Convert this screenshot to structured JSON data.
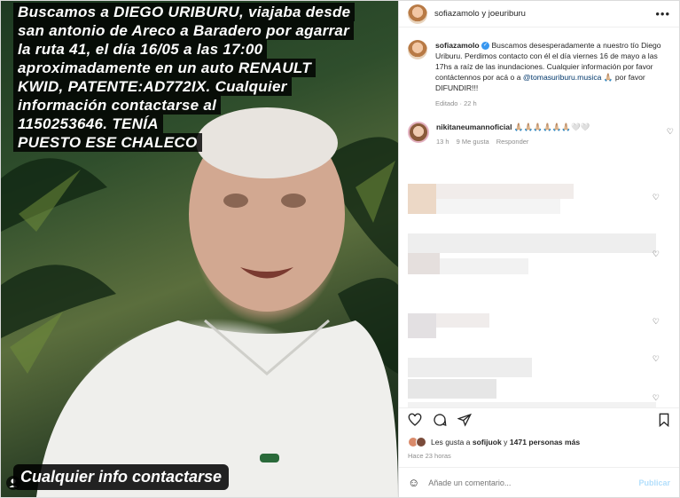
{
  "media": {
    "caption_lines": [
      "Buscamos a DIEGO URIBURU, viajaba desde",
      "san antonio de Areco a Baradero por agarrar",
      "la ruta 41, el día 16/05 a las 17:00",
      "aproximadamente en un auto RENAULT",
      "KWID, PATENTE:AD772IX. Cualquier",
      "información contactarse al",
      "1150253646. TENÍA",
      "PUESTO ESE CHALECO"
    ],
    "bottom_caption": "Cualquier info contactarse"
  },
  "header": {
    "title": "sofiazamolo y joeuriburu",
    "more_icon": "more-horizontal-icon"
  },
  "caption": {
    "user": "sofiazamolo",
    "text_before_mention": "Buscamos desesperadamente a nuestro tío Diego Uriburu. Perdimos contacto con él el día viernes 16 de mayo a las 17hs a raíz de las inundaciones. Cualquier información por favor contáctennos por acá o a",
    "mention": "@tomasuriburu.musica",
    "text_after_mention": "🙏🏼 por favor DIFUNDIR!!!",
    "meta": "Editado · 22 h"
  },
  "comment": {
    "user": "nikitaneumannoficial",
    "text": "🙏🏼🙏🏼🙏🏼🙏🏼🙏🏼🙏🏼🤍🤍",
    "time": "13 h",
    "likes": "9 Me gusta",
    "reply": "Responder"
  },
  "likes": {
    "prefix": "Les gusta a",
    "user": "sofijuok",
    "connector": "y",
    "others": "1471 personas más"
  },
  "post_time": "Hace 23 horas",
  "add_comment": {
    "placeholder": "Añade un comentario...",
    "publish": "Publicar"
  },
  "colors": {
    "accent": "#0095f6",
    "mention": "#00376b",
    "muted": "#8e8e8e",
    "publish_disabled": "#b2dffc"
  }
}
